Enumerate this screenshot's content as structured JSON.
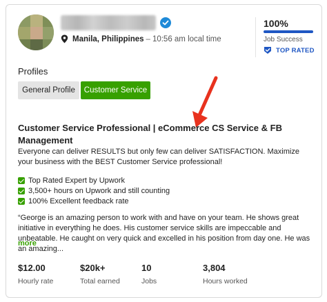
{
  "profile": {
    "location_city": "Manila, Philippines",
    "location_separator": "–",
    "local_time": "10:56 am local time"
  },
  "job_success": {
    "value": "100%",
    "fraction": 1.0,
    "label": "Job Success",
    "badge_label": "TOP RATED",
    "accent_color": "#1f57c3"
  },
  "profiles": {
    "heading": "Profiles",
    "tabs": [
      {
        "label": "General Profile",
        "selected": false
      },
      {
        "label": "Customer Service",
        "selected": true
      }
    ],
    "selected_color": "#37a000"
  },
  "specialized_profile": {
    "title": "Customer Service Professional | eCommerce CS Service & FB Management",
    "overview": "Everyone can deliver RESULTS but only few can deliver SATISFACTION. Maximize your business with the BEST Customer Service professional!",
    "checklist": [
      "Top Rated Expert by Upwork",
      "3,500+ hours on Upwork and still counting",
      "100% Excellent feedback rate"
    ],
    "quote": "“George is an amazing person to work with and have on your team. He shows great initiative in everything he does. His customer service skills are impeccable and unbeatable. He caught on very quick and excelled in his position from day one. He was an amazing...",
    "more_label": "more"
  },
  "stats": [
    {
      "value": "$12.00",
      "label": "Hourly rate"
    },
    {
      "value": "$20k+",
      "label": "Total earned"
    },
    {
      "value": "10",
      "label": "Jobs"
    },
    {
      "value": "3,804",
      "label": "Hours worked"
    }
  ],
  "icons": {
    "verified": "verified-check-icon",
    "location": "map-pin-icon",
    "top_rated": "top-rated-badge-icon",
    "checkbox": "green-check-icon",
    "annotation": "red-arrow-icon"
  },
  "annotation_color": "#e8321e"
}
